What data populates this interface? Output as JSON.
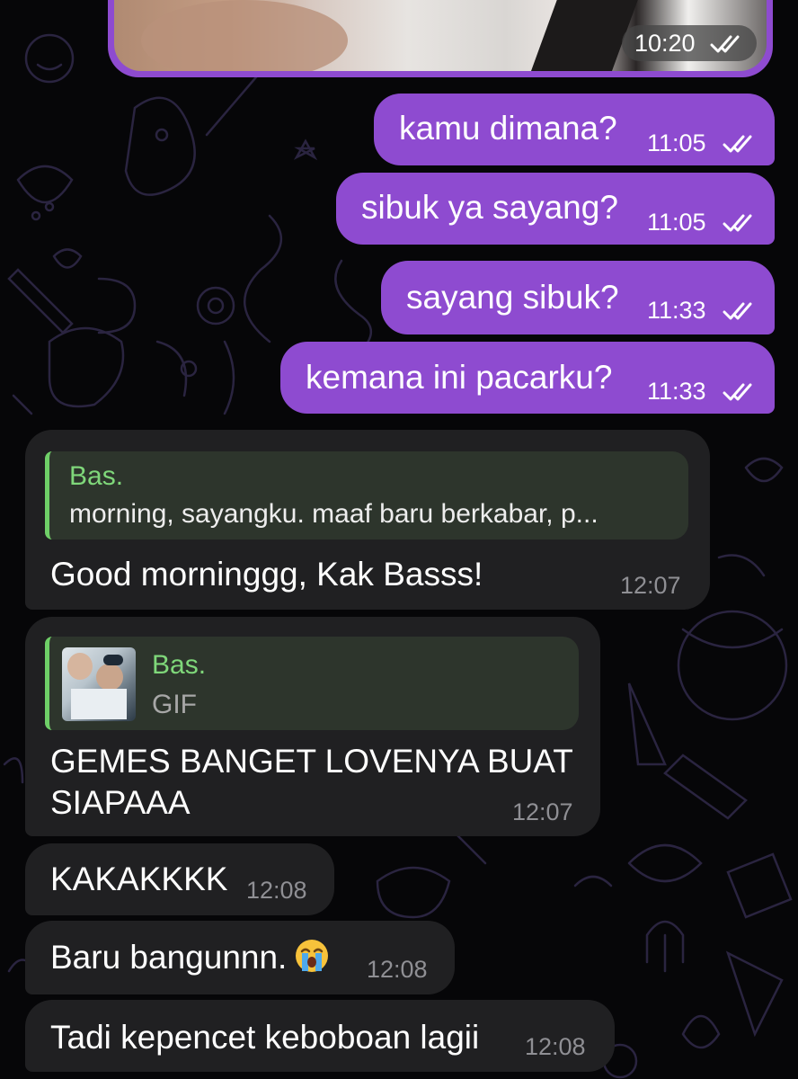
{
  "header_media": {
    "time": "10:20",
    "status": "read"
  },
  "outgoing": [
    {
      "text": "kamu dimana?",
      "time": "11:05",
      "status": "read"
    },
    {
      "text": "sibuk ya sayang?",
      "time": "11:05",
      "status": "read"
    },
    {
      "text": "sayang sibuk?",
      "time": "11:33",
      "status": "read"
    },
    {
      "text": "kemana ini pacarku?",
      "time": "11:33",
      "status": "read"
    }
  ],
  "incoming": [
    {
      "reply": {
        "name": "Bas.",
        "text": "morning, sayangku. maaf baru berkabar, p..."
      },
      "text": "Good morninggg, Kak Basss!",
      "time": "12:07"
    },
    {
      "reply": {
        "name": "Bas.",
        "kind": "GIF"
      },
      "text_line1": "GEMES BANGET LOVENYA BUAT",
      "text_line2": "SIAPAAA",
      "time": "12:07"
    },
    {
      "text": "KAKAKKKK",
      "time": "12:08"
    },
    {
      "text": "Baru bangunnn.",
      "emoji": "loudly-crying-face",
      "time": "12:08"
    },
    {
      "text": "Tadi kepencet keboboan lagii",
      "time": "12:08"
    }
  ],
  "colors": {
    "outgoing_bubble": "#8e4bd0",
    "incoming_bubble": "#202022",
    "reply_accent": "#6fcf68",
    "reply_background": "#2d352c",
    "background": "#060608"
  }
}
